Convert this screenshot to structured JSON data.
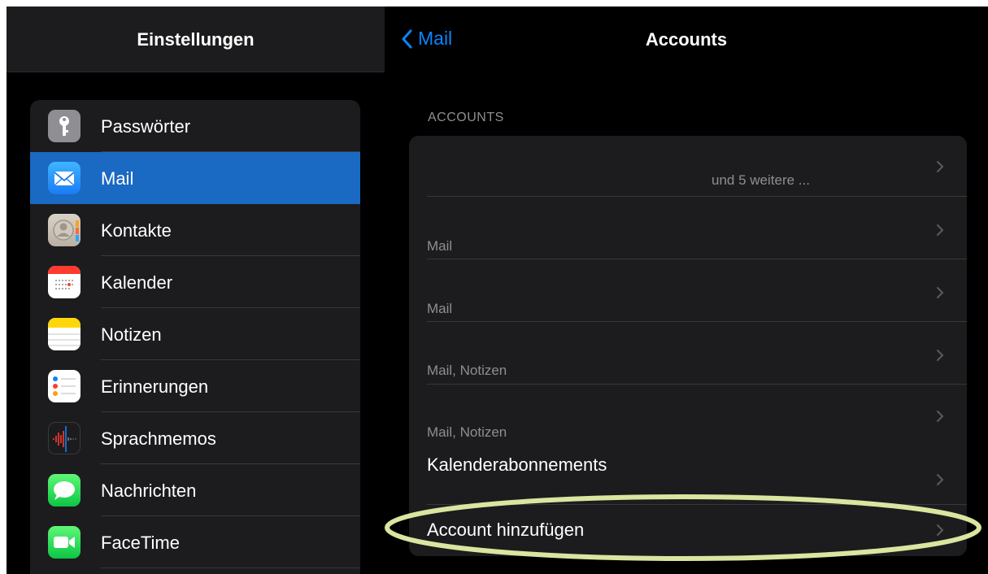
{
  "sidebar": {
    "title": "Einstellungen",
    "items": [
      {
        "label": "Passwörter",
        "icon": "key-icon",
        "selected": false
      },
      {
        "label": "Mail",
        "icon": "mail-icon",
        "selected": true
      },
      {
        "label": "Kontakte",
        "icon": "contacts-icon",
        "selected": false
      },
      {
        "label": "Kalender",
        "icon": "calendar-icon",
        "selected": false
      },
      {
        "label": "Notizen",
        "icon": "notes-icon",
        "selected": false
      },
      {
        "label": "Erinnerungen",
        "icon": "reminders-icon",
        "selected": false
      },
      {
        "label": "Sprachmemos",
        "icon": "voice-memos-icon",
        "selected": false
      },
      {
        "label": "Nachrichten",
        "icon": "messages-icon",
        "selected": false
      },
      {
        "label": "FaceTime",
        "icon": "facetime-icon",
        "selected": false
      }
    ]
  },
  "detail": {
    "back_label": "Mail",
    "title": "Accounts",
    "section_header": "ACCOUNTS",
    "rows": [
      {
        "subtitle": "und 5 weitere ..."
      },
      {
        "subtitle": "Mail"
      },
      {
        "subtitle": "Mail"
      },
      {
        "subtitle": "Mail, Notizen"
      },
      {
        "subtitle": "Mail, Notizen"
      },
      {
        "title": "Kalenderabonnements"
      },
      {
        "title": "Account hinzufügen"
      }
    ]
  },
  "colors": {
    "accent": "#0a84ff",
    "selected_row": "#1a69c2",
    "highlight_ellipse": "#d8e6a0"
  }
}
